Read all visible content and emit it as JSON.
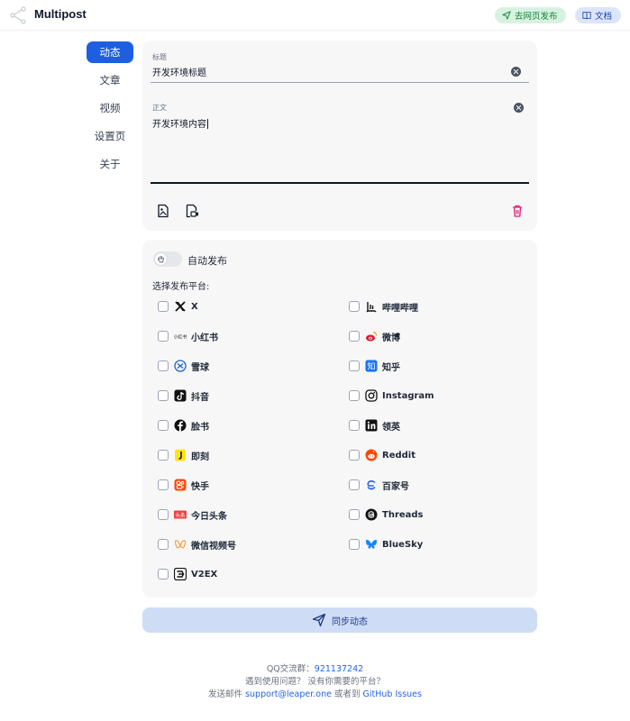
{
  "header": {
    "app_title": "Multipost",
    "web_publish_label": "去网页发布",
    "docs_label": "文档"
  },
  "sidebar": {
    "items": [
      {
        "label": "动态",
        "active": true
      },
      {
        "label": "文章",
        "active": false
      },
      {
        "label": "视频",
        "active": false
      },
      {
        "label": "设置页",
        "active": false
      },
      {
        "label": "关于",
        "active": false
      }
    ]
  },
  "editor": {
    "title_label": "标题",
    "title_value": "开发环境标题",
    "body_label": "正文",
    "body_value": "开发环境内容"
  },
  "publish": {
    "auto_publish_label": "自动发布",
    "auto_publish_on": false,
    "select_platforms_label": "选择发布平台:",
    "platforms": [
      {
        "name": "X",
        "icon": "x-icon"
      },
      {
        "name": "哔哩哔哩",
        "icon": "bilibili-icon"
      },
      {
        "name": "小红书",
        "icon": "xiaohongshu-icon"
      },
      {
        "name": "微博",
        "icon": "weibo-icon"
      },
      {
        "name": "雪球",
        "icon": "xueqiu-icon"
      },
      {
        "name": "知乎",
        "icon": "zhihu-icon"
      },
      {
        "name": "抖音",
        "icon": "douyin-icon"
      },
      {
        "name": "Instagram",
        "icon": "instagram-icon"
      },
      {
        "name": "脸书",
        "icon": "facebook-icon"
      },
      {
        "name": "领英",
        "icon": "linkedin-icon"
      },
      {
        "name": "即刻",
        "icon": "jike-icon"
      },
      {
        "name": "Reddit",
        "icon": "reddit-icon"
      },
      {
        "name": "快手",
        "icon": "kuaishou-icon"
      },
      {
        "name": "百家号",
        "icon": "baijiahao-icon"
      },
      {
        "name": "今日头条",
        "icon": "toutiao-icon"
      },
      {
        "name": "Threads",
        "icon": "threads-icon"
      },
      {
        "name": "微信视频号",
        "icon": "wechat-channels-icon"
      },
      {
        "name": "BlueSky",
        "icon": "bluesky-icon"
      },
      {
        "name": "V2EX",
        "icon": "v2ex-icon"
      }
    ],
    "submit_label": "同步动态"
  },
  "footer": {
    "qq_label": "QQ交流群：",
    "qq_number": "921137242",
    "help_text": "遇到使用问题？ 没有你需要的平台？",
    "email_prefix": "发送邮件 ",
    "email": "support@leaper.one",
    "or_text": " 或者到 ",
    "github_link": "GitHub Issues"
  },
  "colors": {
    "accent": "#1d5fe0",
    "web_publish_bg": "#d7f2e1",
    "docs_bg": "#dbe6fb",
    "submit_bg": "#cfdcf6",
    "delete_icon": "#e11d74"
  }
}
